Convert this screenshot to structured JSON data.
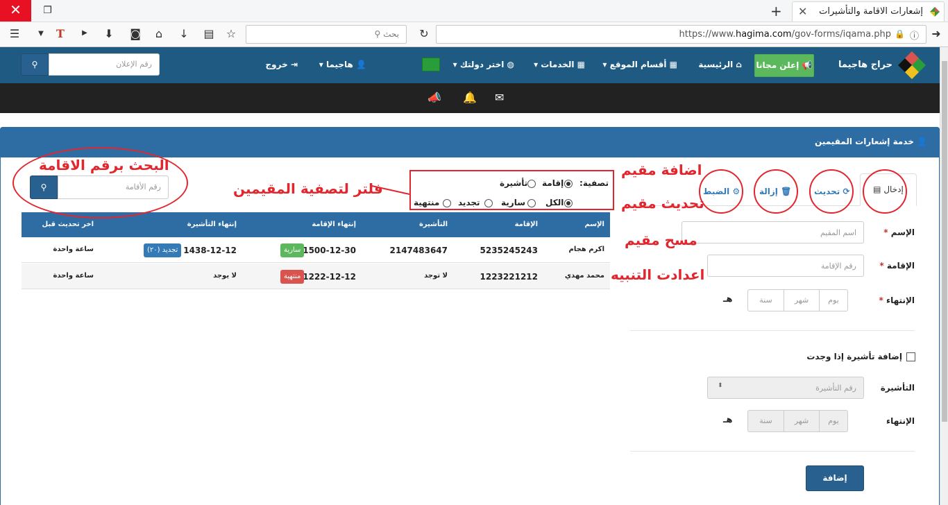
{
  "browser": {
    "tab_title": "إشعارات الاقامة والتأشيرات",
    "search_placeholder": "بحث",
    "url_prefix": "https://www.",
    "url_host": "hagima.com",
    "url_path": "/gov-forms/iqama.php",
    "close": "✕",
    "restore": "❐",
    "tab_close": "✕",
    "new_tab": "+"
  },
  "site_header": {
    "site_name": "حراج هاجيما",
    "advertise_label": "إعلن مجانا",
    "home_label": "الرئيسية",
    "sections_label": "أقسام الموقع",
    "services_label": "الخدمات",
    "country_label": "اختر دولتك",
    "user_label": "هاجيما",
    "logout_label": "خروج",
    "ad_search_placeholder": "رقم الإعلان"
  },
  "panel": {
    "title": "خدمة إشعارات المقيمين"
  },
  "tabs": {
    "entry": "إدخال",
    "refresh": "تحديث",
    "remove": "إزالة",
    "settings": "الضبط"
  },
  "form": {
    "name_label": "الإسم",
    "name_placeholder": "اسم المقيم",
    "iqama_label": "الإقامة",
    "iqama_placeholder": "رقم الإقامة",
    "expiry_label": "الإنتهاء",
    "day": "يوم",
    "month": "شهر",
    "year": "سنة",
    "hijri": "هـ",
    "add_visa_label": "إضافة تأشيرة إذا وجدت",
    "visa_label": "التأشيرة",
    "visa_placeholder": "رقم التأشيرة",
    "visa_expiry_label": "الإنتهاء",
    "required": "*",
    "add_button": "إضافة"
  },
  "filter": {
    "label": "تصفية:",
    "type_iqama": "إقامة",
    "type_visa": "تأشيرة",
    "all": "الكل",
    "valid": "سارية",
    "renew": "تجديد",
    "expired": "منتهية"
  },
  "resident_search": {
    "placeholder": "رقم الأقامة"
  },
  "table": {
    "headers": {
      "name": "الإسم",
      "iqama": "الإقامة",
      "visa": "التأشيرة",
      "iqama_expiry": "إنتهاء الإقامة",
      "visa_expiry": "إنتهاء التأشيرة",
      "last_update": "اخر تحديث قبل"
    },
    "rows": [
      {
        "name": "اكرم هجام",
        "iqama": "5235245243",
        "visa": "2147483647",
        "iqama_expiry": "1500-12-30",
        "iqama_status": "سارية",
        "visa_expiry": "1438-12-12",
        "visa_status": "تجديد (٢٠)",
        "last_update": "ساعة واحدة"
      },
      {
        "name": "محمد مهدي",
        "iqama": "1223221212",
        "visa": "لا توجد",
        "iqama_expiry": "1222-12-12",
        "iqama_status": "منتهية",
        "visa_expiry": "لا يوجد",
        "last_update": "ساعة واحدة"
      }
    ]
  },
  "annotations": {
    "search_by_iqama": "البحث برقم الاقامة",
    "filter_residents": "فلتر لتصفية المقيمين",
    "add_resident": "اضافة مقيم",
    "update_resident": "تحديث مقيم",
    "delete_resident": "مسح مقيم",
    "alert_settings": "اعدادت التنبيه"
  },
  "colors": {
    "header_blue": "#1e5a82",
    "panel_blue": "#2e6da4",
    "success_green": "#5cb85c",
    "danger_red": "#d9534f",
    "info_blue": "#337ab7",
    "annotation_red": "#e2262e"
  }
}
